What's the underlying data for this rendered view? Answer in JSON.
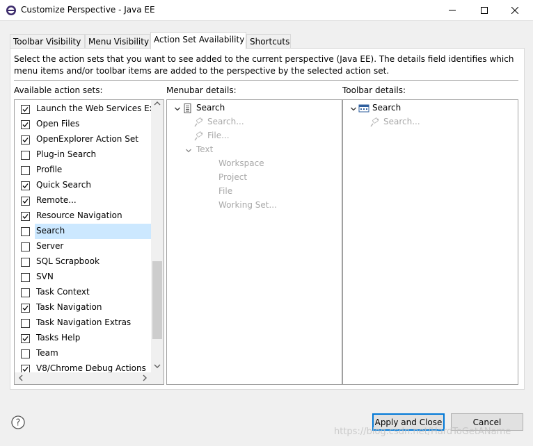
{
  "window": {
    "title": "Customize Perspective - Java EE",
    "icon": "eclipse-icon"
  },
  "tabs": [
    {
      "label": "Toolbar Visibility",
      "active": false
    },
    {
      "label": "Menu Visibility",
      "active": false
    },
    {
      "label": "Action Set Availability",
      "active": true
    },
    {
      "label": "Shortcuts",
      "active": false
    }
  ],
  "description": "Select the action sets that you want to see added to the current perspective (Java EE).  The details field identifies which menu items and/or toolbar items are added to the perspective by the selected action set.",
  "labels": {
    "available": "Available action sets:",
    "menubar": "Menubar details:",
    "toolbar": "Toolbar details:"
  },
  "action_sets": [
    {
      "label": "Launch the Web Services Exp",
      "checked": true
    },
    {
      "label": "Open Files",
      "checked": true
    },
    {
      "label": "OpenExplorer Action Set",
      "checked": true
    },
    {
      "label": "Plug-in Search",
      "checked": false
    },
    {
      "label": "Profile",
      "checked": false
    },
    {
      "label": "Quick Search",
      "checked": true
    },
    {
      "label": "Remote...",
      "checked": true
    },
    {
      "label": "Resource Navigation",
      "checked": true
    },
    {
      "label": "Search",
      "checked": false,
      "selected": true
    },
    {
      "label": "Server",
      "checked": false
    },
    {
      "label": "SQL Scrapbook",
      "checked": false
    },
    {
      "label": "SVN",
      "checked": false
    },
    {
      "label": "Task Context",
      "checked": false
    },
    {
      "label": "Task Navigation",
      "checked": true
    },
    {
      "label": "Task Navigation Extras",
      "checked": false
    },
    {
      "label": "Tasks Help",
      "checked": true
    },
    {
      "label": "Team",
      "checked": false
    },
    {
      "label": "V8/Chrome Debug Actions",
      "checked": true
    }
  ],
  "menubar_tree": [
    {
      "label": "Search",
      "level": 0,
      "expanded": true,
      "icon": "menu-icon",
      "disabled": false
    },
    {
      "label": "Search...",
      "level": 1,
      "icon": "search-action-icon",
      "disabled": true
    },
    {
      "label": "File...",
      "level": 1,
      "icon": "search-action-icon",
      "disabled": true
    },
    {
      "label": "Text",
      "level": 1,
      "expanded": true,
      "icon": "folder-icon",
      "disabled": true
    },
    {
      "label": "Workspace",
      "level": 2,
      "disabled": true
    },
    {
      "label": "Project",
      "level": 2,
      "disabled": true
    },
    {
      "label": "File",
      "level": 2,
      "disabled": true
    },
    {
      "label": "Working Set...",
      "level": 2,
      "disabled": true
    }
  ],
  "toolbar_tree": [
    {
      "label": "Search",
      "level": 0,
      "expanded": true,
      "icon": "toolbar-icon",
      "disabled": false
    },
    {
      "label": "Search...",
      "level": 1,
      "icon": "search-action-icon",
      "disabled": true
    }
  ],
  "buttons": {
    "apply": "Apply and Close",
    "cancel": "Cancel"
  },
  "watermark": "https://blog.csdn.net/HardToGetAName",
  "colors": {
    "selection": "#cce8ff",
    "default_button_border": "#0078d7",
    "disabled_text": "#a8a8a8"
  }
}
